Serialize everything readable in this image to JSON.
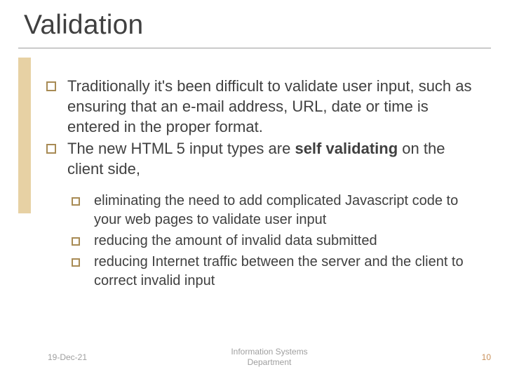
{
  "title": "Validation",
  "bullets": [
    {
      "text": "Traditionally it's been difficult to validate user input, such as ensuring that an e-mail address, URL, date or time is entered in the proper format."
    },
    {
      "text_prefix": "The new HTML 5 input types are ",
      "text_bold": "self validating",
      "text_suffix": " on the client side,"
    }
  ],
  "subbullets": [
    {
      "text": "eliminating the need to add complicated Javascript code to your web pages to validate user input"
    },
    {
      "text": "reducing the amount of invalid data submitted"
    },
    {
      "text": "reducing Internet traffic between the server and the client to correct invalid input"
    }
  ],
  "footer": {
    "date": "19-Dec-21",
    "center_line1": "Information Systems",
    "center_line2": "Department",
    "page": "10"
  }
}
